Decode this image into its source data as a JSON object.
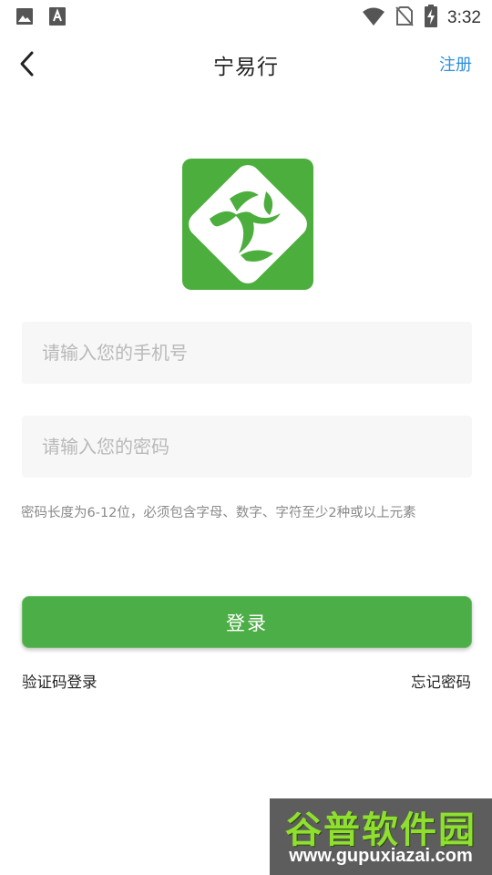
{
  "status_bar": {
    "time": "3:32",
    "icons": [
      "image-icon",
      "text-a-icon",
      "wifi-icon",
      "no-sim-icon",
      "battery-charging-icon"
    ]
  },
  "header": {
    "title": "宁易行",
    "register_label": "注册",
    "back_icon": "chevron-left-icon"
  },
  "colors": {
    "brand_green": "#4cae3c",
    "link_blue": "#2f8fe0"
  },
  "form": {
    "phone_placeholder": "请输入您的手机号",
    "password_placeholder": "请输入您的密码",
    "password_hint": "密码长度为6-12位，必须包含字母、数字、字符至少2种或以上元素",
    "login_label": "登录"
  },
  "links": {
    "sms_login": "验证码登录",
    "forgot_password": "忘记密码"
  },
  "watermark": {
    "name": "谷普软件园",
    "url": "www.gupuxiazai.com"
  }
}
